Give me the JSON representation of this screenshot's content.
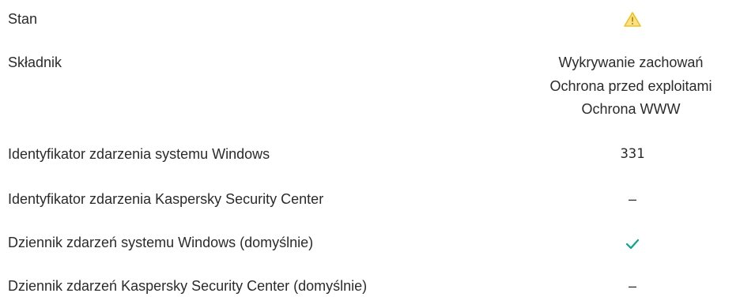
{
  "rows": [
    {
      "label": "Stan",
      "icon": "warning-icon",
      "warning_color": "#f5c518"
    },
    {
      "label": "Składnik",
      "values": [
        "Wykrywanie zachowań",
        "Ochrona przed exploitami",
        "Ochrona WWW"
      ]
    },
    {
      "label": "Identyfikator zdarzenia systemu Windows",
      "value": "331"
    },
    {
      "label": "Identyfikator zdarzenia Kaspersky Security Center",
      "value": "–"
    },
    {
      "label": "Dziennik zdarzeń systemu Windows (domyślnie)",
      "icon": "checkmark-icon",
      "check_color": "#00a88e"
    },
    {
      "label": "Dziennik zdarzeń Kaspersky Security Center (domyślnie)",
      "value": "–"
    }
  ]
}
